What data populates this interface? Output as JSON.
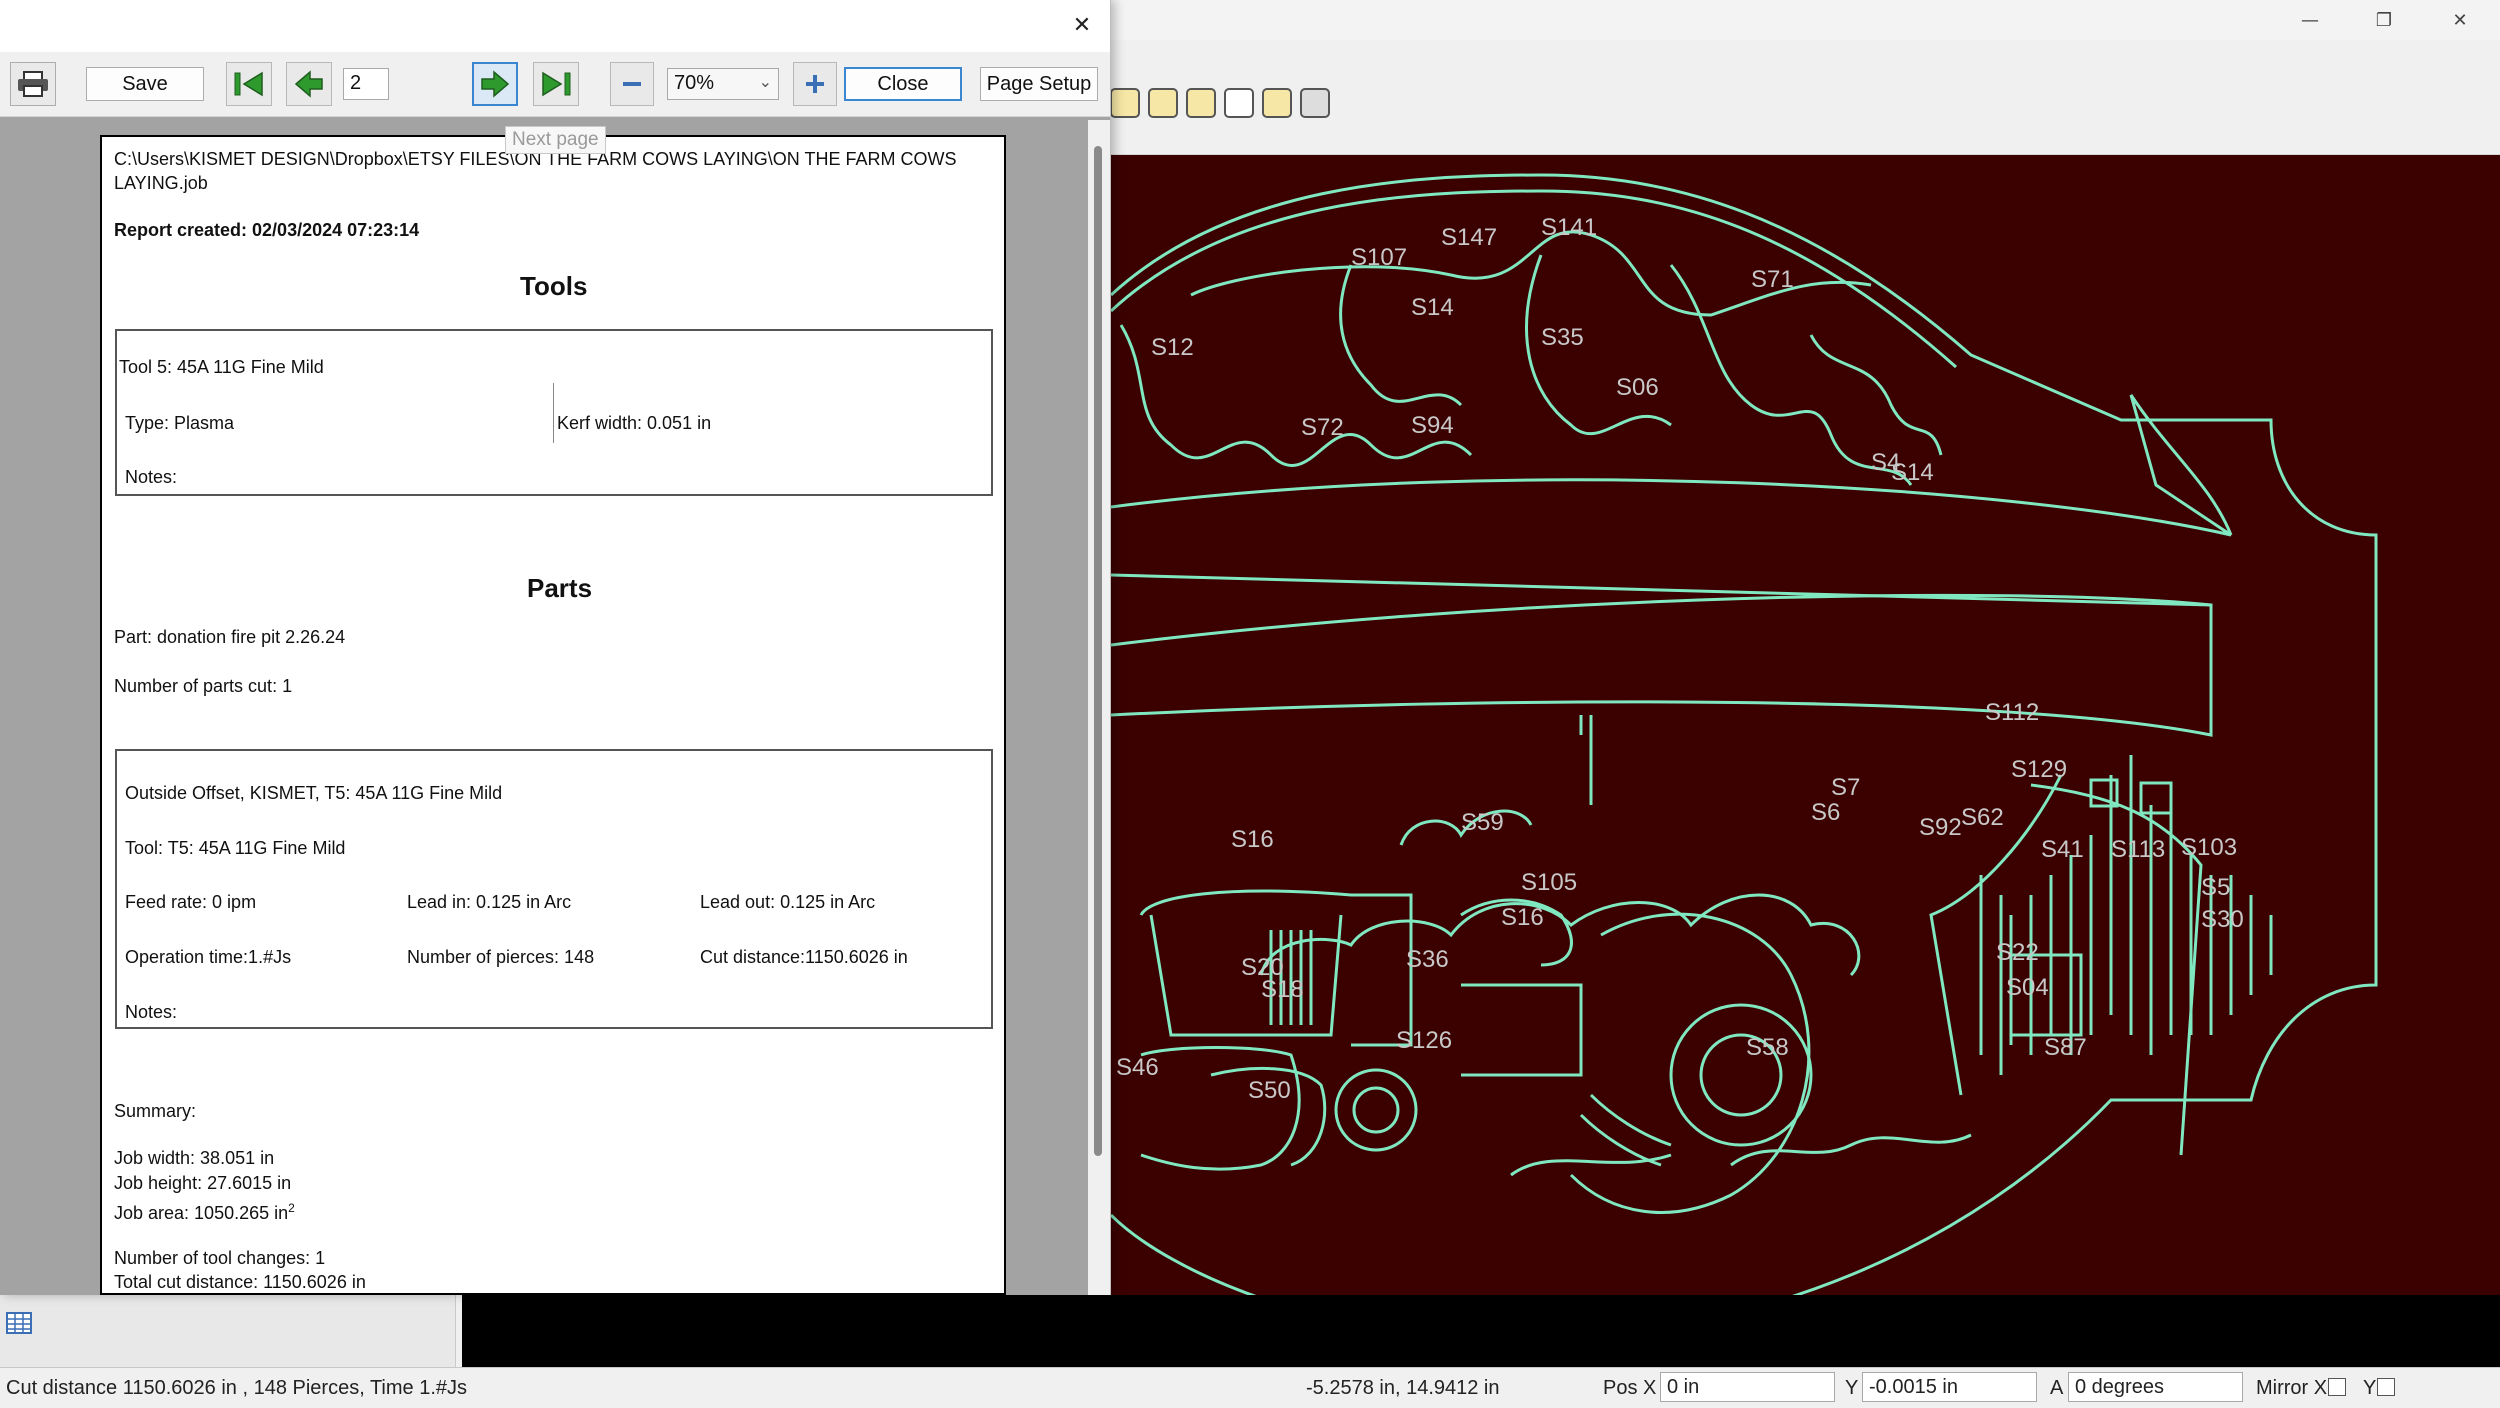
{
  "preview": {
    "toolbar": {
      "save": "Save",
      "page_number": "2",
      "zoom": "70%",
      "close": "Close",
      "page_setup": "Page Setup",
      "tooltip": "Next page"
    },
    "report": {
      "path": "C:\\Users\\KISMET DESIGN\\Dropbox\\ETSY FILES\\ON THE FARM COWS LAYING\\ON THE FARM COWS",
      "path_cont": "LAYING.job",
      "created": "Report created: 02/03/2024 07:23:14",
      "tools_heading": "Tools",
      "tool_name": "Tool 5: 45A 11G Fine Mild",
      "tool_type": "Type: Plasma",
      "kerf": "Kerf width: 0.051 in",
      "tool_notes": "Notes:",
      "parts_heading": "Parts",
      "part": "Part: donation fire pit 2.26.24",
      "parts_cut": "Number of parts cut: 1",
      "op_title": "Outside Offset, KISMET, T5: 45A 11G Fine Mild",
      "op_tool": "Tool: T5: 45A 11G Fine Mild",
      "feed": "Feed rate: 0 ipm",
      "lead_in": "Lead in: 0.125 in Arc",
      "lead_out": "Lead out: 0.125 in Arc",
      "op_time": "Operation time:1.#Js",
      "pierces": "Number of pierces: 148",
      "cut_distance": "Cut distance:1150.6026 in",
      "op_notes": "Notes:",
      "summary": "Summary:",
      "job_width": "Job width: 38.051 in",
      "job_height": "Job height: 27.6015 in",
      "job_area": "Job area: 1050.265 in",
      "job_area_sup": "2",
      "tool_changes": "Number of tool changes: 1",
      "total_cut": "Total cut distance: 1150.6026 in"
    }
  },
  "canvas": {
    "labels": [
      "S147",
      "S141",
      "S107",
      "S14",
      "S71",
      "S12",
      "S72",
      "S94",
      "S35",
      "S06",
      "S4",
      "S14",
      "S112",
      "S129",
      "S7",
      "S6",
      "S92",
      "S62",
      "S41",
      "S113",
      "S103",
      "S5",
      "S30",
      "S59",
      "S105",
      "S16",
      "S18",
      "S126",
      "S50",
      "S36",
      "S58",
      "S22",
      "S04",
      "S87",
      "S46",
      "S16",
      "S20"
    ]
  },
  "statusbar": {
    "cut_info": "Cut distance 1150.6026 in , 148 Pierces, Time 1.#Js",
    "cursor_pos": "-5.2578 in, 14.9412 in",
    "pos_x_label": "Pos X",
    "pos_x": "0 in",
    "y_label": "Y",
    "y": "-0.0015 in",
    "a_label": "A",
    "a": "0 degrees",
    "mirror_x_label": "Mirror X",
    "mirror_y_label": "Y"
  },
  "colors": {
    "canvas_bg": "#3b0000",
    "cut_path": "#7fe8c0",
    "label": "#c8c8c8",
    "nav_arrow": "#2e9a2e"
  }
}
